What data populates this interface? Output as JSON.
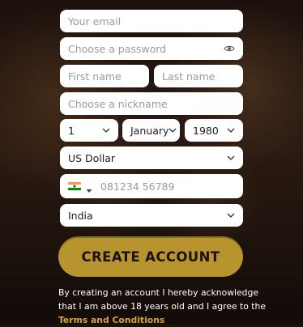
{
  "form": {
    "email": {
      "placeholder": "Your email"
    },
    "password": {
      "placeholder": "Choose a password",
      "toggle_icon": "eye-icon"
    },
    "first_name": {
      "placeholder": "First name"
    },
    "last_name": {
      "placeholder": "Last name"
    },
    "nickname": {
      "placeholder": "Choose a nickname"
    },
    "dob": {
      "day": "1",
      "month": "January",
      "year": "1980"
    },
    "currency": {
      "selected": "US Dollar"
    },
    "phone": {
      "placeholder": "081234 56789",
      "flag_icon": "india-flag-icon"
    },
    "country": {
      "selected": "India"
    },
    "cta": {
      "label": "CREATE ACCOUNT",
      "color": "#b8942e"
    },
    "disclaimer": {
      "text": "By creating an account I hereby acknowledge that I am above 18 years old and I agree to the",
      "terms_link": "Terms and Conditions",
      "terms_color": "#d6a52a"
    }
  }
}
